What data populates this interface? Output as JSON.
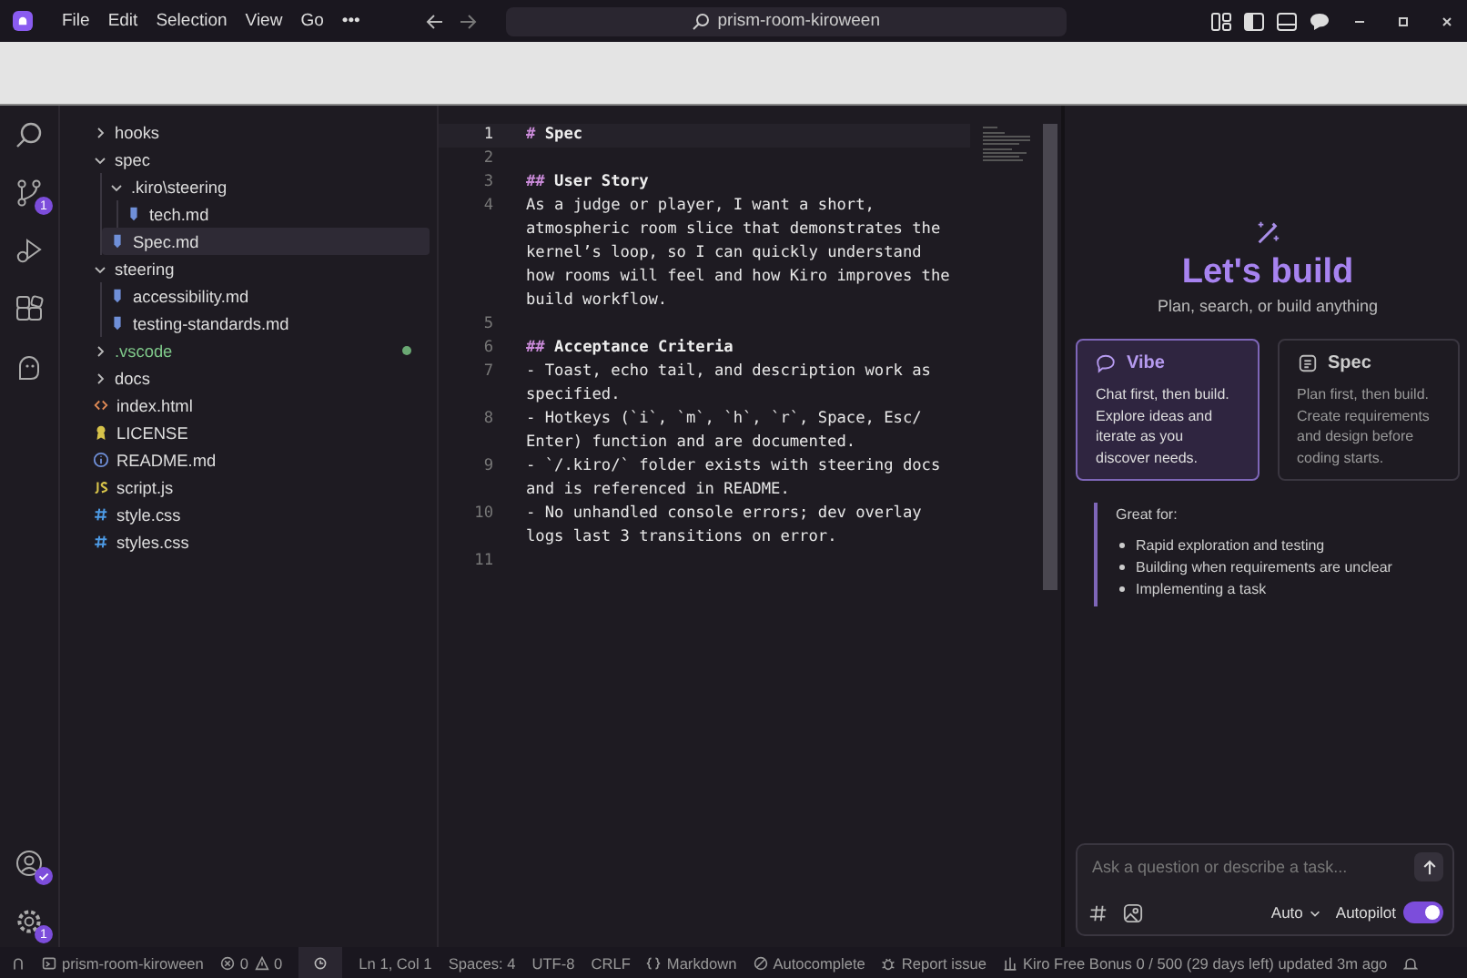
{
  "title_bar": {
    "menus": [
      "File",
      "Edit",
      "Selection",
      "View",
      "Go",
      "•••"
    ],
    "search": "prism-room-kiroween"
  },
  "activity_bar": {
    "source_control_badge": "1",
    "settings_badge": "1"
  },
  "explorer": {
    "items": [
      {
        "name": "hooks",
        "kind": "folder",
        "expanded": false,
        "selected": false,
        "modified": false
      },
      {
        "name": "spec",
        "kind": "folder",
        "expanded": true,
        "selected": false,
        "modified": false,
        "children": [
          {
            "name": ".kiro\\steering",
            "kind": "folder",
            "expanded": true,
            "selected": false,
            "modified": false,
            "children": [
              {
                "name": "tech.md",
                "kind": "md",
                "selected": false,
                "modified": false
              }
            ]
          },
          {
            "name": "Spec.md",
            "kind": "md",
            "selected": true,
            "modified": false
          }
        ]
      },
      {
        "name": "steering",
        "kind": "folder",
        "expanded": true,
        "selected": false,
        "modified": false,
        "children": [
          {
            "name": "accessibility.md",
            "kind": "md",
            "selected": false,
            "modified": false
          },
          {
            "name": "testing-standards.md",
            "kind": "md",
            "selected": false,
            "modified": false
          }
        ]
      },
      {
        "name": ".vscode",
        "kind": "folder",
        "expanded": false,
        "selected": false,
        "modified": true
      },
      {
        "name": "docs",
        "kind": "folder",
        "expanded": false,
        "selected": false,
        "modified": false
      },
      {
        "name": "index.html",
        "kind": "html",
        "selected": false,
        "modified": false
      },
      {
        "name": "LICENSE",
        "kind": "license",
        "selected": false,
        "modified": false
      },
      {
        "name": "README.md",
        "kind": "info",
        "selected": false,
        "modified": false
      },
      {
        "name": "script.js",
        "kind": "js",
        "selected": false,
        "modified": false
      },
      {
        "name": "style.css",
        "kind": "css",
        "selected": false,
        "modified": false
      },
      {
        "name": "styles.css",
        "kind": "css",
        "selected": false,
        "modified": false
      }
    ]
  },
  "editor": {
    "lines": [
      {
        "number": "1",
        "kind": "heading",
        "mark": "#",
        "rows": [
          "Spec"
        ],
        "selected": true
      },
      {
        "number": "2",
        "kind": "blank",
        "selected": false
      },
      {
        "number": "3",
        "kind": "heading",
        "mark": "##",
        "rows": [
          "User Story"
        ],
        "selected": false
      },
      {
        "number": "4",
        "kind": "text",
        "rows": [
          "As a judge or player, I want a short,",
          "atmospheric room slice that demonstrates the",
          "kernel’s loop, so I can quickly understand",
          "how rooms will feel and how Kiro improves the",
          "build workflow."
        ],
        "selected": false
      },
      {
        "number": "5",
        "kind": "blank",
        "selected": false
      },
      {
        "number": "6",
        "kind": "heading",
        "mark": "##",
        "rows": [
          "Acceptance Criteria"
        ],
        "selected": false
      },
      {
        "number": "7",
        "kind": "text",
        "rows": [
          "- Toast, echo tail, and description work as",
          "specified."
        ],
        "selected": false
      },
      {
        "number": "8",
        "kind": "text",
        "rows": [
          "- Hotkeys (`i`, `m`, `h`, `r`, Space, Esc/",
          "Enter) function and are documented."
        ],
        "selected": false
      },
      {
        "number": "9",
        "kind": "text",
        "rows": [
          "- `/.kiro/` folder exists with steering docs",
          "and is referenced in README."
        ],
        "selected": false
      },
      {
        "number": "10",
        "kind": "text",
        "rows": [
          "- No unhandled console errors; dev overlay",
          "logs last 3 transitions on error."
        ],
        "selected": false
      },
      {
        "number": "11",
        "kind": "blank",
        "selected": false
      }
    ]
  },
  "chat": {
    "title": "Let's build",
    "subtitle": "Plan, search, or build anything",
    "modes": [
      {
        "kind": "chat",
        "name": "Vibe",
        "description": "Chat first, then build. Explore ideas and iterate as you discover needs.",
        "selected": true
      },
      {
        "kind": "spec",
        "name": "Spec",
        "description": "Plan first, then build. Create requirements and design before coding starts.",
        "selected": false
      }
    ],
    "great_for": {
      "heading": "Great for:",
      "items": [
        "Rapid exploration and testing",
        "Building when requirements are unclear",
        "Implementing a task"
      ]
    },
    "input": {
      "placeholder": "Ask a question or describe a task..."
    },
    "model": "Auto",
    "autopilot": {
      "label": "Autopilot",
      "on": true
    }
  },
  "status_bar": {
    "workspace": "prism-room-kiroween",
    "errors": "0",
    "warnings": "0",
    "position": "Ln 1, Col 1",
    "spaces": "Spaces: 4",
    "encoding": "UTF-8",
    "eol": "CRLF",
    "language": "Markdown",
    "autocomplete": "Autocomplete",
    "report": "Report issue",
    "usage": "Kiro Free Bonus 0 / 500 (29 days left) updated 3m ago"
  }
}
